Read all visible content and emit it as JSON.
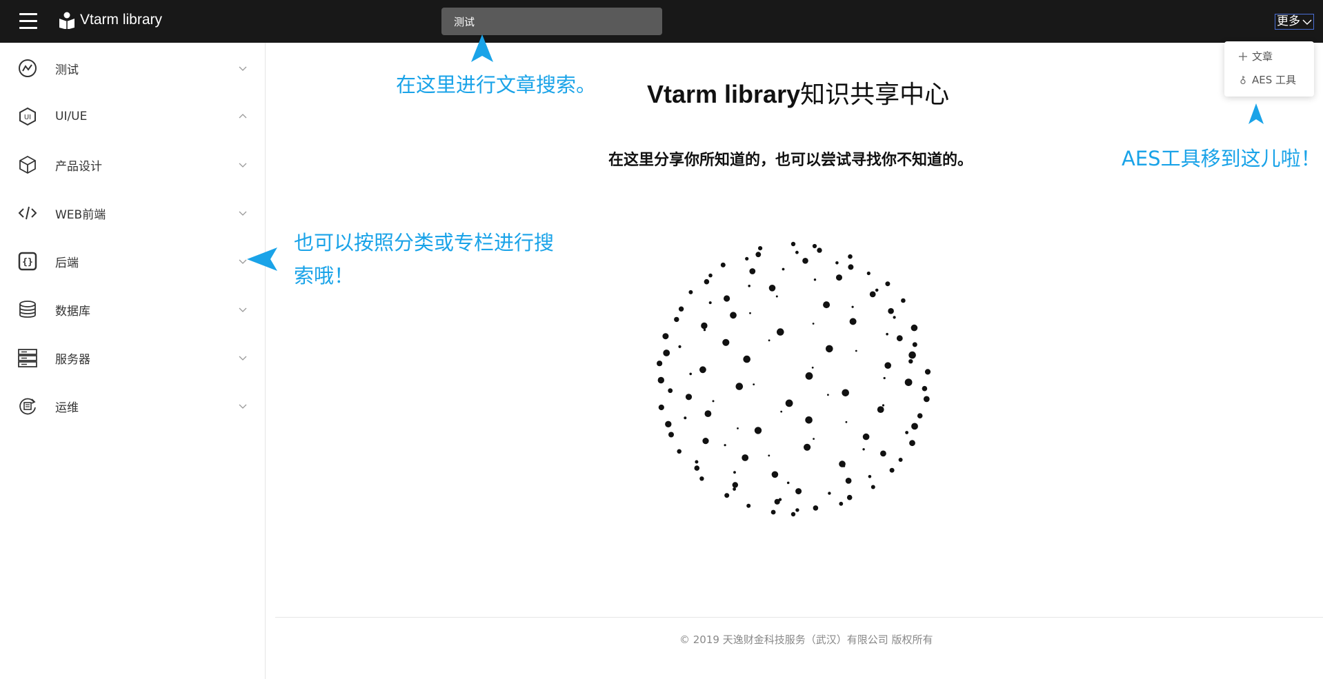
{
  "header": {
    "brand_title": "Vtarm library",
    "search_value": "测试",
    "more_label": "更多"
  },
  "dropdown": {
    "items": [
      {
        "icon": "plus-icon",
        "label": "文章"
      },
      {
        "icon": "key-icon",
        "label": "AES 工具"
      }
    ]
  },
  "sidebar": {
    "items": [
      {
        "icon": "chart-icon",
        "label": "测试",
        "expanded": false
      },
      {
        "icon": "ui-icon",
        "label": "UI/UE",
        "expanded": true
      },
      {
        "icon": "cube-icon",
        "label": "产品设计",
        "expanded": false
      },
      {
        "icon": "code-icon",
        "label": "WEB前端",
        "expanded": false
      },
      {
        "icon": "braces-icon",
        "label": "后端",
        "expanded": false
      },
      {
        "icon": "database-icon",
        "label": "数据库",
        "expanded": false
      },
      {
        "icon": "server-icon",
        "label": "服务器",
        "expanded": false
      },
      {
        "icon": "ops-icon",
        "label": "运维",
        "expanded": false
      }
    ]
  },
  "main": {
    "title_en": "Vtarm library",
    "title_cn": "知识共享中心",
    "subtitle": "在这里分享你所知道的，也可以尝试寻找你不知道的。"
  },
  "annotations": {
    "search_hint": "在这里进行文章搜索。",
    "category_hint_line1": "也可以按照分类或专栏进行搜",
    "category_hint_line2": "索哦！",
    "aes_hint": "AES工具移到这儿啦！"
  },
  "footer": {
    "copyright": "© 2019 天逸财金科技服务（武汉）有限公司 版权所有"
  },
  "colors": {
    "topbar": "#181818",
    "annotation": "#1aa3e8",
    "search_bg": "#5a5a5a"
  }
}
